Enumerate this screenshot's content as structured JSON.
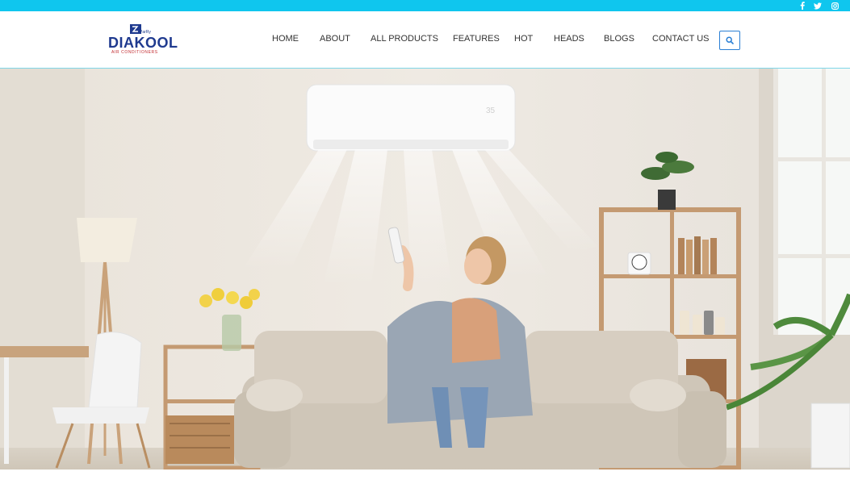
{
  "topbar": {
    "color": "#0fc6ee",
    "social": [
      {
        "name": "facebook",
        "icon": "facebook-icon"
      },
      {
        "name": "twitter",
        "icon": "twitter-icon"
      },
      {
        "name": "instagram",
        "icon": "instagram-icon"
      }
    ]
  },
  "brand": {
    "name": "DIAKOOL",
    "tagline": "AIR CONDITIONERS",
    "mark_text": "ParRy",
    "primary_color": "#1f3a8f",
    "accent_color": "#c0282d"
  },
  "nav": {
    "items": [
      "HOME",
      "ABOUT",
      "ALL PRODUCTS",
      "FEATURES",
      "HOT",
      "HEADS",
      "BLOGS",
      "CONTACT US"
    ],
    "search_icon": "search-icon"
  },
  "hero": {
    "image": "woman-on-sofa-using-air-conditioner-remote"
  }
}
